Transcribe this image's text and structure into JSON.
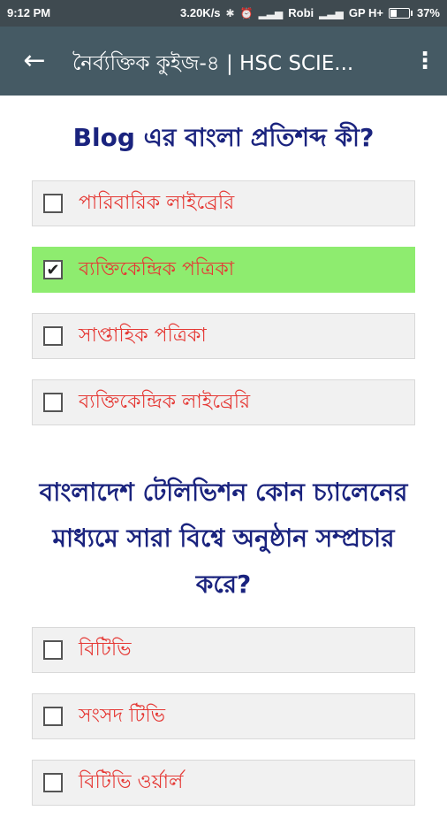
{
  "status_bar": {
    "time": "9:12 PM",
    "network_speed": "3.20K/s",
    "carrier1": "Robi",
    "carrier2": "GP H+",
    "battery": "37%",
    "battery_level": 0.37
  },
  "app_bar": {
    "back_icon": "arrow-left-icon",
    "title": "নৈর্ব্যক্তিক কুইজ-৪ | HSC SCIE...",
    "menu_icon": "more-vert-icon"
  },
  "questions": [
    {
      "text": "Blog এর বাংলা প্রতিশব্দ কী?",
      "options": [
        {
          "label": "পারিবারিক লাইব্রেরি",
          "checked": false
        },
        {
          "label": "ব্যক্তিকেন্দ্রিক পত্রিকা",
          "checked": true
        },
        {
          "label": "সাপ্তাহিক পত্রিকা",
          "checked": false
        },
        {
          "label": "ব্যক্তিকেন্দ্রিক লাইব্রেরি",
          "checked": false
        }
      ]
    },
    {
      "text": "বাংলাদেশ টেলিভিশন কোন চ্যালেনের মাধ্যমে সারা বিশ্বে অনুষ্ঠান সম্প্রচার করে?",
      "options": [
        {
          "label": "বিটিভি",
          "checked": false
        },
        {
          "label": "সংসদ টিভি",
          "checked": false
        },
        {
          "label": "বিটিভি ওর্য়ার্ল",
          "checked": false
        }
      ]
    }
  ],
  "colors": {
    "app_bar": "#455a64",
    "status_bar": "#3f4a50",
    "question_text": "#1a237e",
    "option_text": "#e53935",
    "selected_option": "#8eec6f"
  }
}
